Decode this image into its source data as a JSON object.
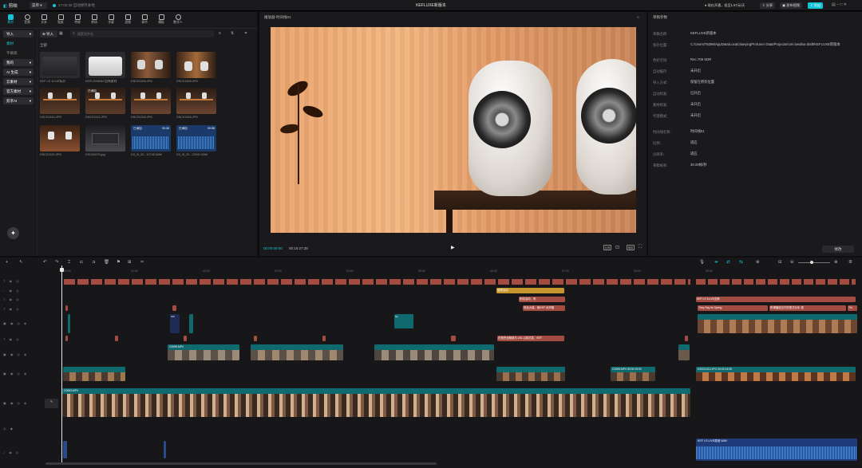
{
  "app": {
    "logo": "剪映",
    "menu_label": "菜单",
    "status": "17:02:30 自动保存本地",
    "title": "KEFLUXE新版本",
    "vip_text": "现在开通，低至1.57元/天",
    "share_label": "分享",
    "publish_label": "发布视频",
    "export_label": "导出"
  },
  "colors": {
    "accent": "#14c4d6",
    "audio_clip": "#a34d42",
    "text_clip": "#c8952d",
    "video_clip": "#0f6a70"
  },
  "resources": {
    "tabs": [
      "素材",
      "音频",
      "文本",
      "贴纸",
      "特效",
      "转场",
      "字幕",
      "滤镜",
      "调节",
      "模板",
      "数字人"
    ],
    "sidebar": [
      "导入",
      "素材",
      "字幕稿",
      "我的",
      "AI 生成",
      "云素材",
      "官方素材",
      "剪享AI"
    ],
    "import_label": "导入",
    "search_placeholder": "搜索文件名",
    "all_label": "全部",
    "items": [
      {
        "name": "KEF LS 1LIVE标识",
        "type": "device-dark"
      },
      {
        "name": "KEFLSXWMO音响素材",
        "type": "device-white"
      },
      {
        "name": "DSC01306.JPG",
        "type": "photo"
      },
      {
        "name": "DSC01308.JPG",
        "type": "photo"
      },
      {
        "name": "DSC01310.JPG",
        "type": "shelf",
        "badge": "已添加"
      },
      {
        "name": "DSC01312.JPG",
        "type": "shelf",
        "badge": "已添加"
      },
      {
        "name": "DSC01326.JPG",
        "type": "shelf"
      },
      {
        "name": "DSC01326.JPG",
        "type": "shelf"
      },
      {
        "name": "DSC01320.JPG",
        "type": "shelf2"
      },
      {
        "name": "DSC00675.jpg",
        "type": "desk"
      },
      {
        "name": "D3_0l_20...10743.WAV",
        "type": "audio",
        "badge": "已添加",
        "duration": "00:30"
      },
      {
        "name": "D3_0l_20...22941.WAV",
        "type": "audio",
        "badge": "已添加",
        "duration": "00:56"
      }
    ]
  },
  "player": {
    "title": "播放器-时间线01",
    "current_time": "00:00:00:00",
    "total_time": "00:15:27:28",
    "controls": [
      "比例",
      "裁剪",
      "全屏"
    ]
  },
  "details": {
    "title": "草稿参数",
    "modify_label": "修改",
    "rows": [
      {
        "label": "草稿名称:",
        "value": "KEFLUXE新版本"
      },
      {
        "label": "保存位置:",
        "value": "C:/Users/78396/AppData/Local/JianyingPro/User Data/Projects/com.lveditor.draft/KEFLUXE新版本"
      },
      {
        "label": "色彩空间:",
        "value": "Rec.709 SDR"
      },
      {
        "label": "自动缓存:",
        "value": "未开启"
      },
      {
        "label": "导入方式:",
        "value": "保留在原有位置"
      },
      {
        "label": "自动校准:",
        "value": "已开启"
      },
      {
        "label": "素材校准:",
        "value": "未开启"
      },
      {
        "label": "代理模式:",
        "value": "未开启"
      },
      {
        "label": "时间线名称:",
        "value": "时间线01"
      },
      {
        "label": "比例:",
        "value": "适应"
      },
      {
        "label": "分辨率:",
        "value": "适应"
      },
      {
        "label": "草稿帧率:",
        "value": "30.00帧/秒"
      }
    ]
  },
  "timeline": {
    "ruler": [
      "00:00",
      "01:00",
      "02:00",
      "03:00",
      "04:00",
      "05:00",
      "06:00",
      "07:00",
      "08:00",
      "09:00"
    ],
    "cover_label": "封面",
    "labels": {
      "gold1": "感恩活动",
      "gold2": "阶段活动，有",
      "red_sub": "低加大能，和KEF 对开箱",
      "red_title": "KEF LS 1LIVE这种",
      "sub_a": "They Say its Spring",
      "sub_b": "所谓播放交付的型式对手·语",
      "sub_c": "Thi",
      "sub_d": "仍是完全解锁与 LNL-Q将式发，KEF",
      "clip_a": "C0099.MP4",
      "clip_b": "C0063.MP4",
      "clip_c": "C0095.MP4",
      "clip_d": "DSC01312.JPG",
      "clip_e": "00:02:24:05",
      "clip_f": "00:00:19:02",
      "audio_name": "KEF LS LIVE原音.WAV",
      "side_card": "Sp",
      "side_card2": "Sch"
    }
  }
}
